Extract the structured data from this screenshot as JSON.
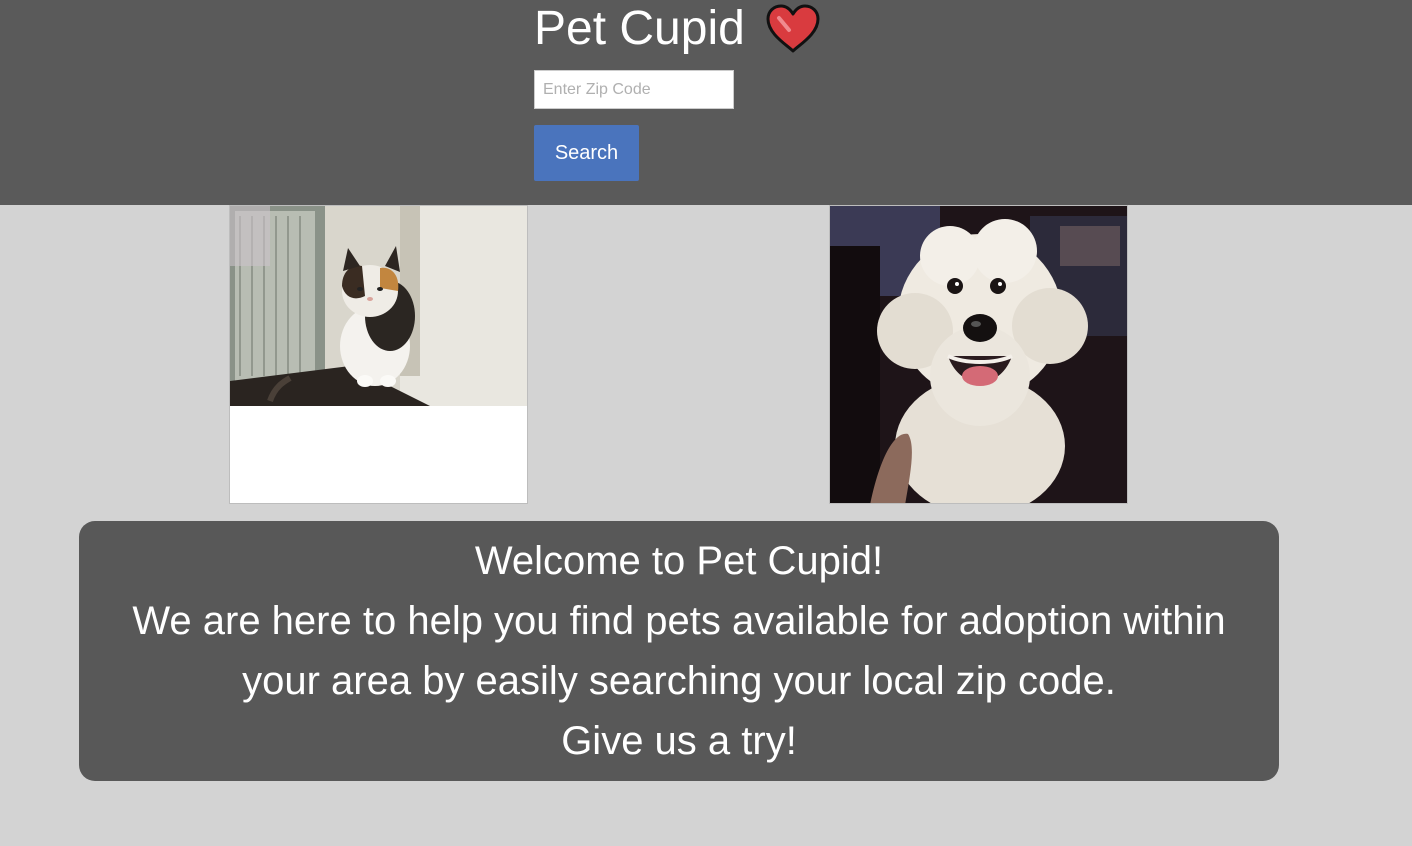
{
  "header": {
    "title": "Pet Cupid",
    "logo_icon": "heart-icon",
    "zip_placeholder": "Enter Zip Code",
    "zip_value": "",
    "search_label": "Search"
  },
  "pets": [
    {
      "kind": "cat",
      "icon": "cat-photo"
    },
    {
      "kind": "dog",
      "icon": "dog-photo"
    }
  ],
  "welcome": {
    "heading": "Welcome to Pet Cupid!",
    "body": "We are here to help you find pets available for adoption within your area by easily searching your local zip code.",
    "cta": "Give us a try!"
  },
  "colors": {
    "header_bg": "#5a5a5a",
    "page_bg": "#d3d3d3",
    "button_bg": "#4a74bd",
    "heart_red": "#d93b3f",
    "panel_bg": "#585858"
  }
}
